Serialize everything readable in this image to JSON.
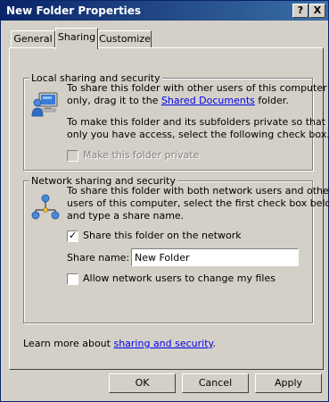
{
  "window": {
    "title": "New Folder Properties",
    "help_label": "?",
    "close_label": "X"
  },
  "tabs": [
    {
      "label": "General"
    },
    {
      "label": "Sharing"
    },
    {
      "label": "Customize"
    }
  ],
  "local": {
    "group_label": "Local sharing and security",
    "text1": "To share this folder with other users of this computer",
    "text2_pre": "only, drag it to the ",
    "text2_link": "Shared Documents",
    "text2_post": " folder.",
    "text3": "To make this folder and its subfolders private so that",
    "text4": "only you have access, select the following check box.",
    "private_label": "Make this folder private",
    "private_checked": false,
    "private_enabled": false
  },
  "network": {
    "group_label": "Network sharing and security",
    "text1": "To share this folder with both network users and other",
    "text2": "users of this computer, select the first check box below",
    "text3": "and type a share name.",
    "share_label": "Share this folder on the network",
    "share_checked": true,
    "share_name_label": "Share name:",
    "share_name_value": "New Folder",
    "allow_change_label": "Allow network users to change my files",
    "allow_change_checked": false
  },
  "learn_more": {
    "pre": "Learn more about ",
    "link": "sharing and security",
    "post": "."
  },
  "buttons": {
    "ok": "OK",
    "cancel": "Cancel",
    "apply": "Apply"
  }
}
